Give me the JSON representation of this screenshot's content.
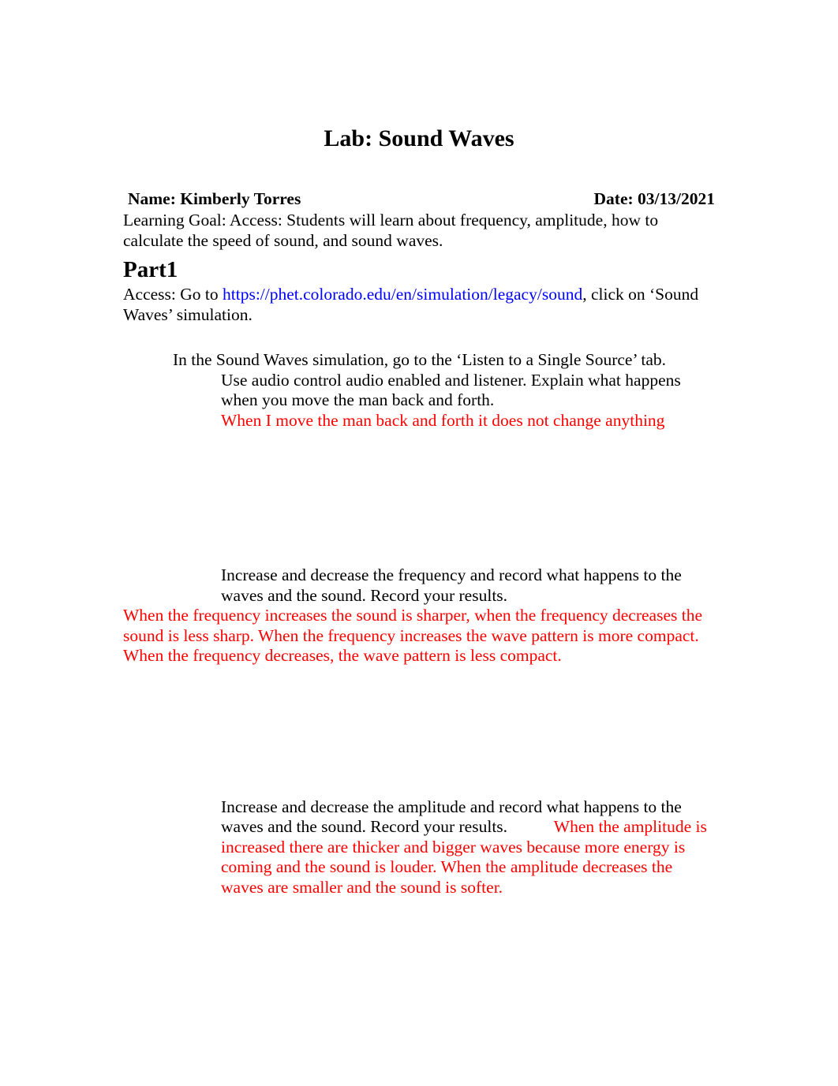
{
  "document": {
    "title": "Lab: Sound Waves",
    "header": {
      "name_label": " Name: Kimberly Torres",
      "date_label": "Date: 03/13/2021"
    },
    "learning_goal": "Learning Goal: Access:  Students will learn about frequency, amplitude, how to calculate the speed of sound, and sound waves.",
    "part1": {
      "heading": "Part1",
      "access_prefix": "Access:  Go to ",
      "access_link": "https://phet.colorado.edu/en/simulation/legacy/sound",
      "access_suffix": ", click on ‘Sound Waves’ simulation."
    },
    "tasks": [
      {
        "instruction_level1": "In the Sound Waves simulation, go to the ‘Listen to a Single Source’ tab.",
        "instruction_level2": "Use audio control audio enabled and listener. Explain what happens when you move the man back and forth.",
        "answer": "When I move the man back and forth it does not change anything"
      },
      {
        "instruction_level2": "Increase and decrease the frequency and record what happens to the waves and the sound. Record your results.",
        "answer": "When the frequency increases the sound is sharper, when the frequency decreases the sound is less sharp. When the frequency increases the wave pattern is more compact. When the frequency decreases, the wave pattern is less compact."
      },
      {
        "instruction_level2": "Increase and decrease the amplitude and record what happens to the waves and the sound. Record your results.",
        "answer_gap": "           ",
        "answer": "When the amplitude is increased there are thicker and bigger waves because more energy is coming and the sound is louder. When the amplitude decreases the waves are smaller and the sound is softer."
      }
    ],
    "colors": {
      "text": "#000000",
      "link": "#0000ff",
      "answer": "#ff0000",
      "page_background": "#ffffff"
    }
  }
}
